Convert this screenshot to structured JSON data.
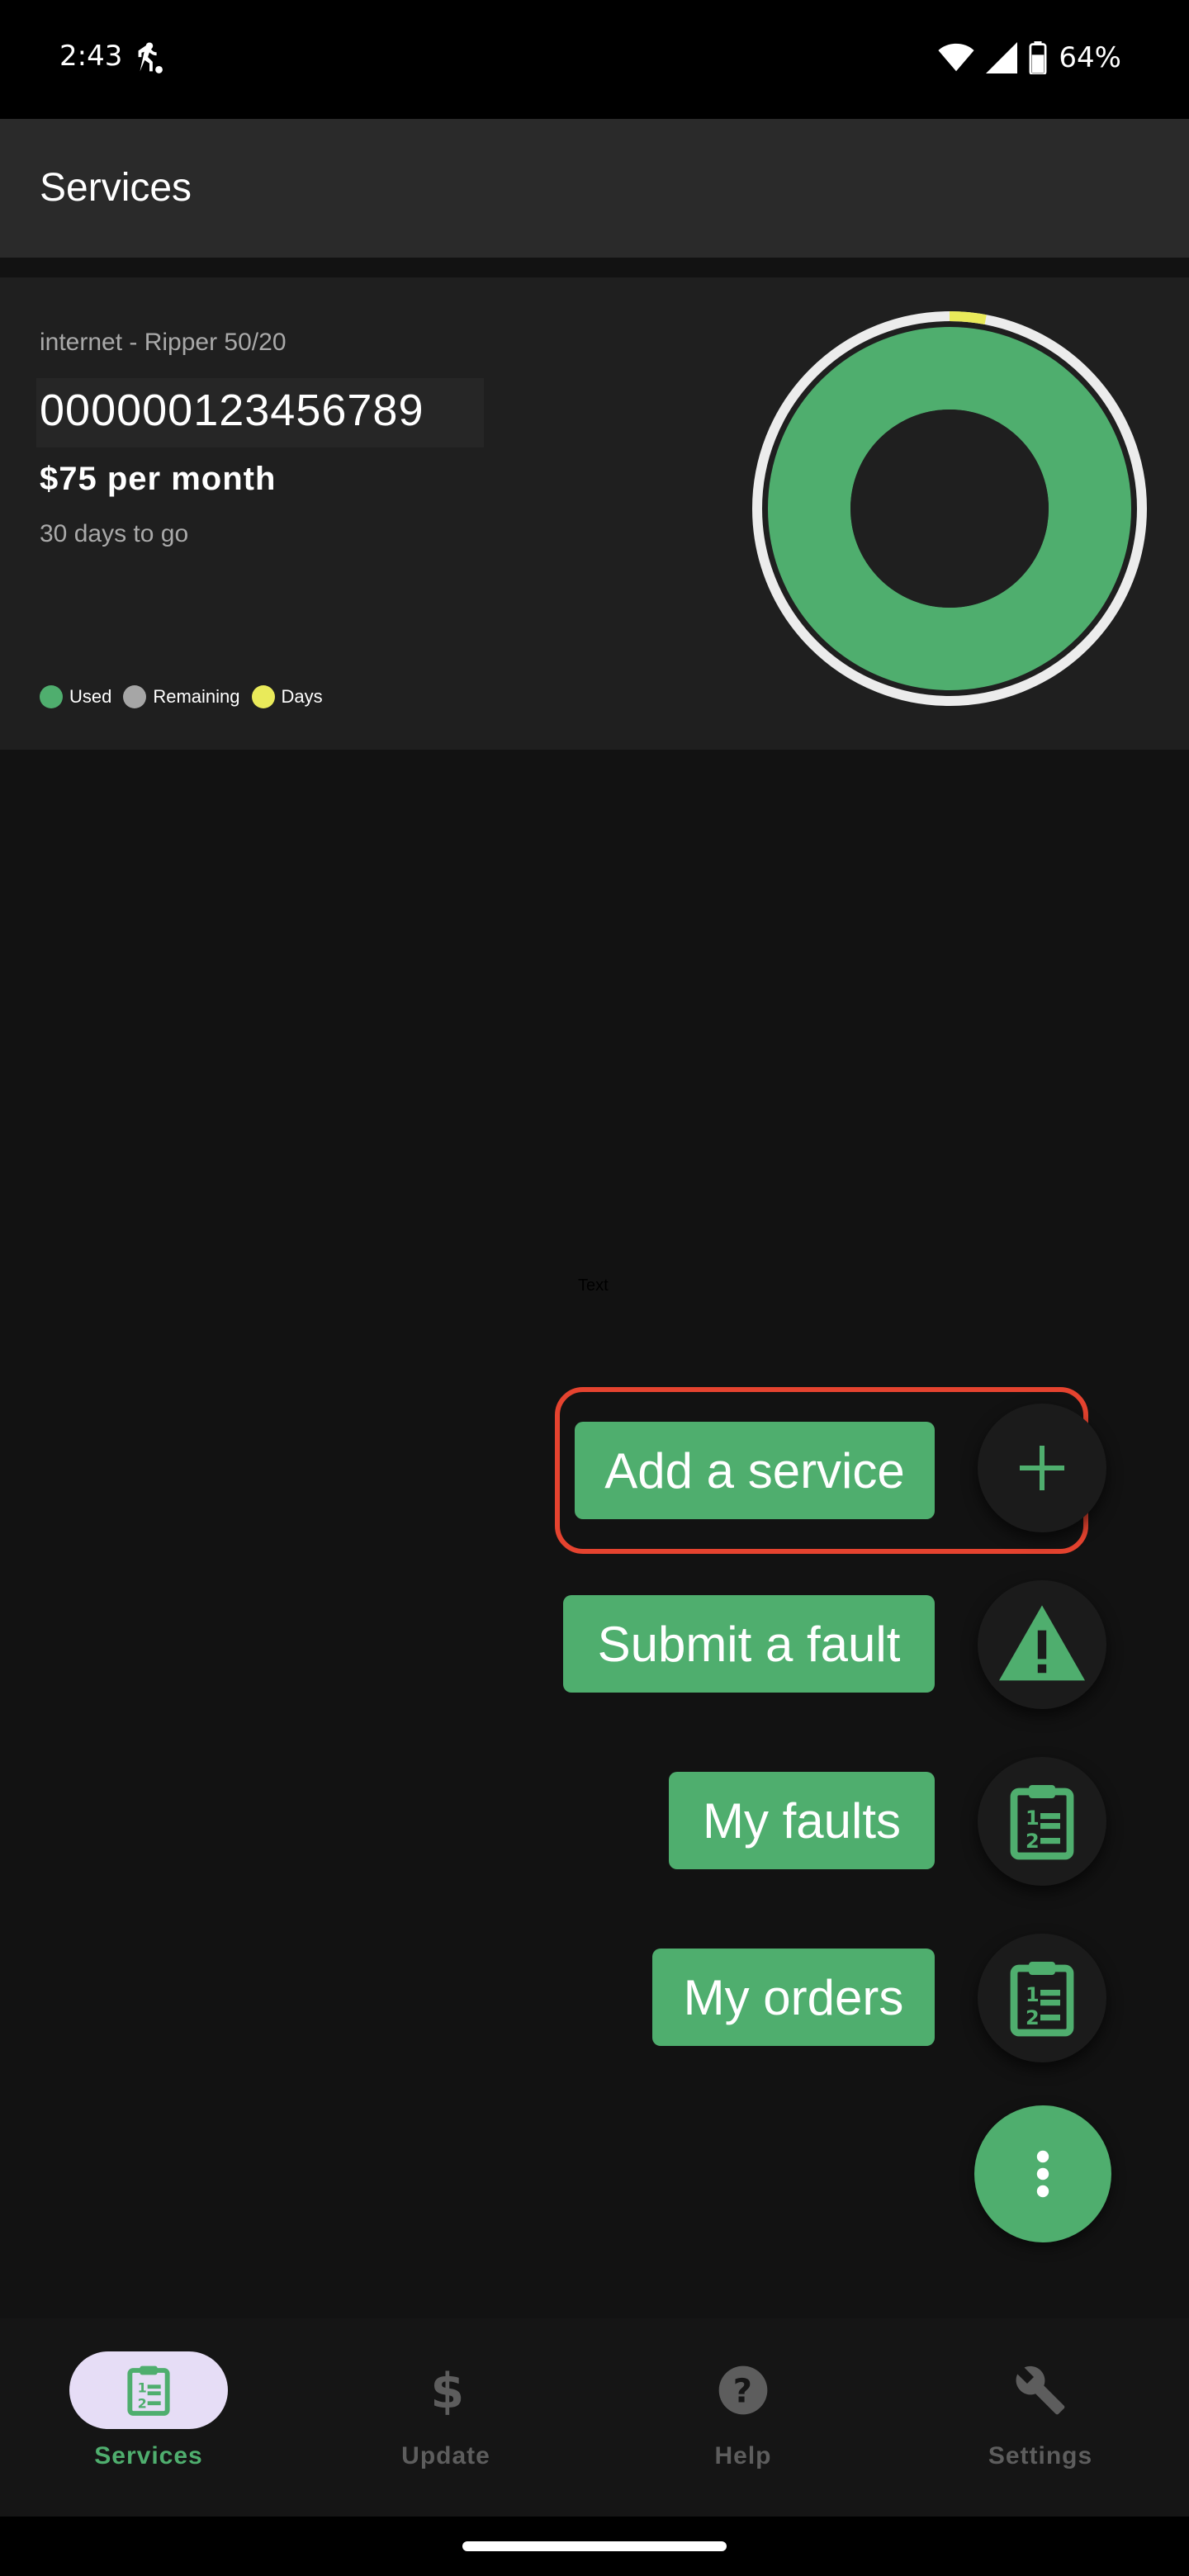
{
  "status_bar": {
    "time": "2:43",
    "battery_text": "64%",
    "icons": [
      "activity-icon",
      "wifi-icon",
      "signal-icon",
      "battery-icon"
    ]
  },
  "app_bar": {
    "title": "Services"
  },
  "service_card": {
    "name": "internet - Ripper 50/20",
    "number": "000000123456789",
    "price": "$75 per month",
    "days_left": "30 days to go",
    "usage": {
      "used_fraction": 1.0,
      "days_elapsed_fraction": 0.03
    },
    "legend": [
      {
        "label": "Used",
        "color": "#4fae6e"
      },
      {
        "label": "Remaining",
        "color": "#a6a6a6"
      },
      {
        "label": "Days",
        "color": "#e9ea5a"
      }
    ]
  },
  "placeholder_text": "Text",
  "fab_menu": {
    "items": [
      {
        "label": "Add a service",
        "icon": "plus-icon"
      },
      {
        "label": "Submit a fault",
        "icon": "warning-icon"
      },
      {
        "label": "My faults",
        "icon": "clipboard-list-icon"
      },
      {
        "label": "My orders",
        "icon": "clipboard-list-icon"
      }
    ],
    "main_icon": "more-vert-icon"
  },
  "bottom_nav": {
    "items": [
      {
        "label": "Services",
        "icon": "clipboard-list-icon",
        "active": true
      },
      {
        "label": "Update",
        "icon": "dollar-icon",
        "active": false
      },
      {
        "label": "Help",
        "icon": "help-circle-icon",
        "active": false
      },
      {
        "label": "Settings",
        "icon": "wrench-icon",
        "active": false
      }
    ]
  },
  "colors": {
    "accent": "#4fae6e",
    "highlight": "#e5432f",
    "nav_inactive": "#5d5d5d",
    "nav_active_pill": "#e6ddf6"
  }
}
